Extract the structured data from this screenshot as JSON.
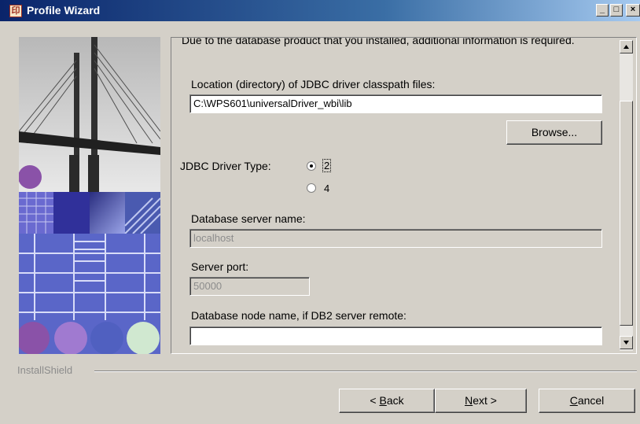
{
  "window": {
    "title": "Profile Wizard",
    "controls": [
      "_",
      "□",
      "×"
    ]
  },
  "content": {
    "intro": "Due to the database product that you installed, additional information is required.",
    "classpath_label": "Location (directory) of JDBC driver classpath files:",
    "classpath_value": "C:\\WPS601\\universalDriver_wbi\\lib",
    "browse_label": "Browse...",
    "driver_type_label": "JDBC Driver Type:",
    "driver_type_options": [
      "2",
      "4"
    ],
    "driver_type_selected": "2",
    "server_name_label": "Database server name:",
    "server_name_value": "localhost",
    "server_port_label": "Server port:",
    "server_port_value": "50000",
    "node_name_label": "Database node name, if DB2 server remote:",
    "node_name_value": ""
  },
  "footer": {
    "brand": "InstallShield",
    "back_prefix": "< ",
    "back_mnemonic": "B",
    "back_rest": "ack",
    "next_mnemonic": "N",
    "next_rest": "ext >",
    "cancel_mnemonic": "C",
    "cancel_rest": "ancel"
  },
  "colors": {
    "titlebar_start": "#0a246a",
    "titlebar_end": "#a6caf0",
    "face": "#d4d0c8"
  }
}
